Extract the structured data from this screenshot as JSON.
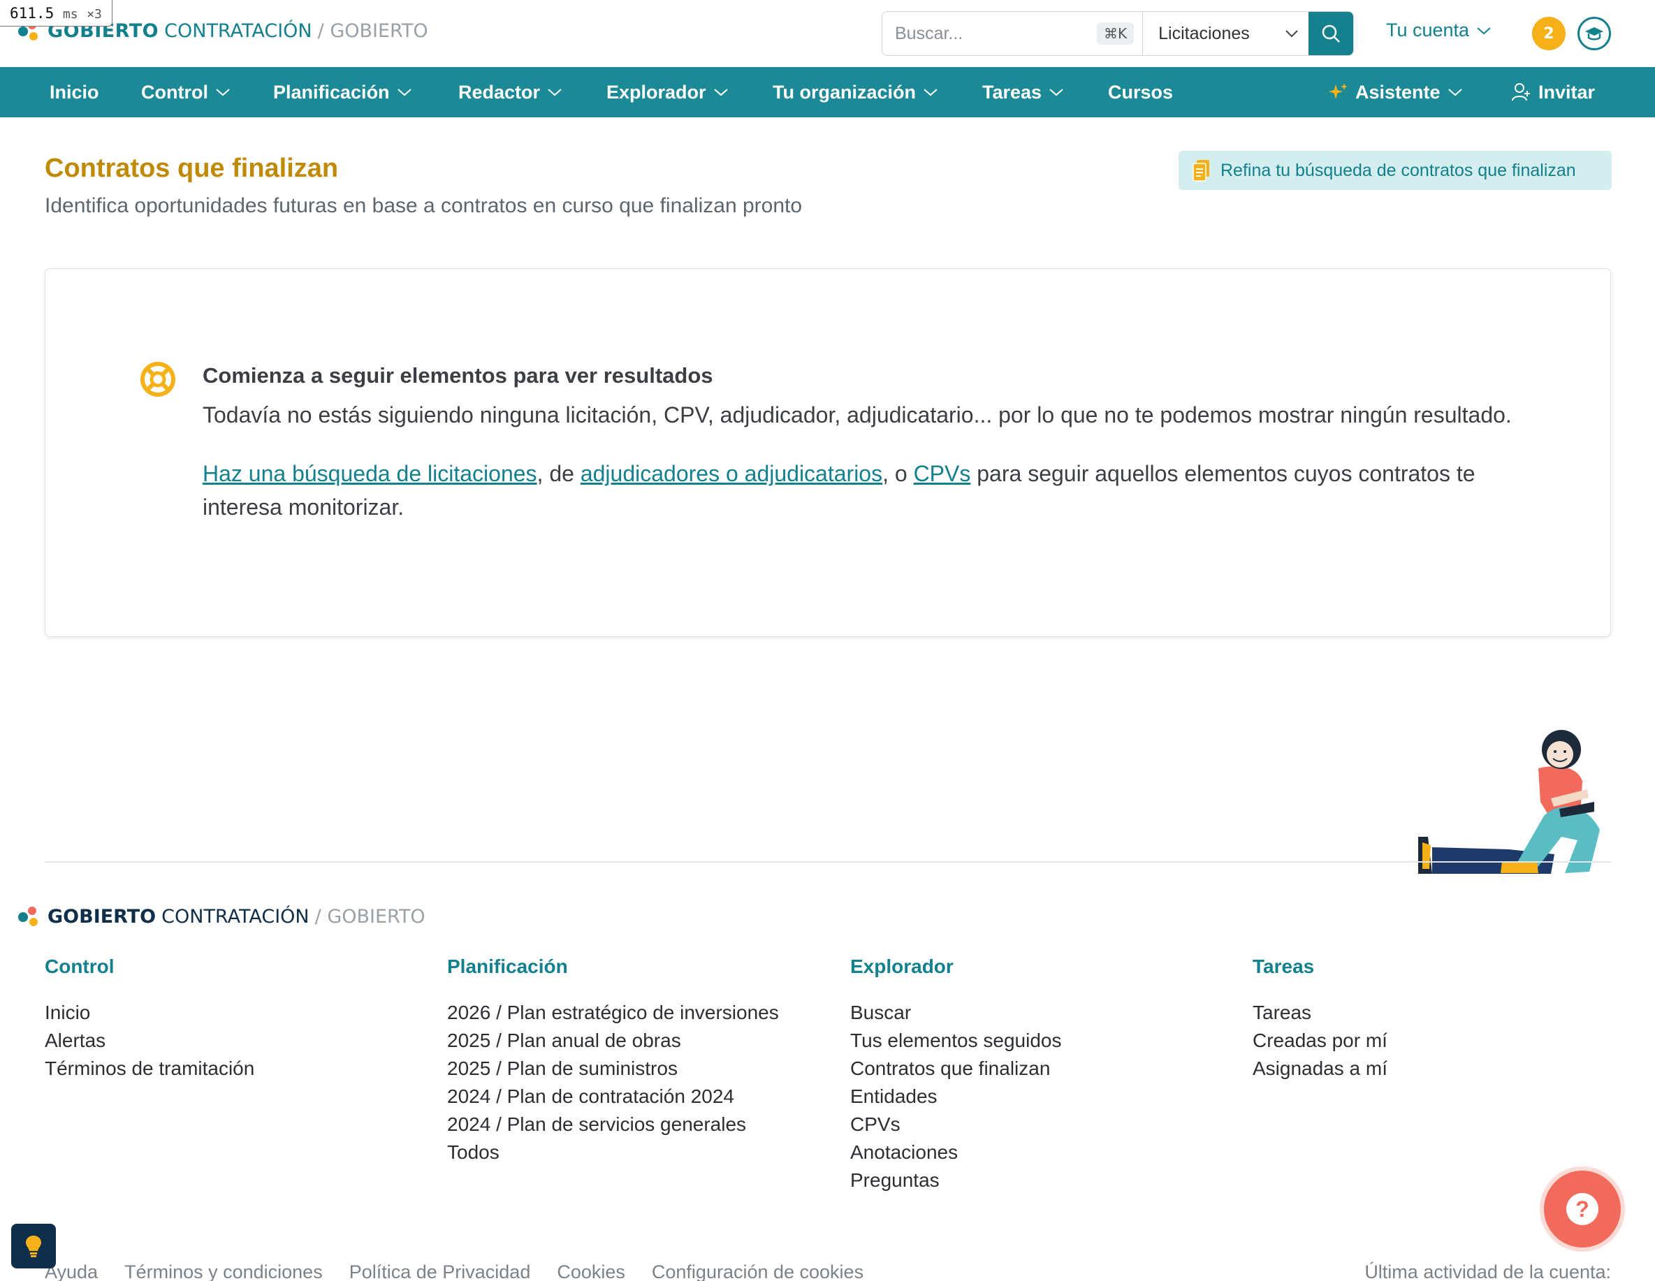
{
  "perf": {
    "value": "611.5",
    "unit": "ms",
    "mult": "×3"
  },
  "brand": {
    "strong": "GOBIERTO",
    "light": "CONTRATACIÓN",
    "sep": "/ GOBIERTO"
  },
  "search": {
    "placeholder": "Buscar...",
    "shortcut": "⌘K",
    "scope": "Licitaciones"
  },
  "account": {
    "label": "Tu cuenta",
    "notifications": "2"
  },
  "nav": {
    "items": [
      {
        "label": "Inicio"
      },
      {
        "label": "Control"
      },
      {
        "label": "Planificación"
      },
      {
        "label": "Redactor"
      },
      {
        "label": "Explorador"
      },
      {
        "label": "Tu organización"
      },
      {
        "label": "Tareas"
      },
      {
        "label": "Cursos"
      }
    ],
    "assistant": "Asistente",
    "invite": "Invitar"
  },
  "page": {
    "title": "Contratos que finalizan",
    "subtitle": "Identifica oportunidades futuras en base a contratos en curso que finalizan pronto",
    "refine": "Refina tu búsqueda de contratos que finalizan"
  },
  "empty": {
    "heading": "Comienza a seguir elementos para ver resultados",
    "text": "Todavía no estás siguiendo ninguna licitación, CPV, adjudicador, adjudicatario... por lo que no te podemos mostrar ningún resultado.",
    "link1": "Haz una búsqueda de licitaciones",
    "mid1": ", de ",
    "link2": "adjudicadores o adjudicatarios",
    "mid2": ", o ",
    "link3": "CPVs",
    "tail": " para seguir aquellos elementos cuyos contratos te interesa monitorizar."
  },
  "footer": {
    "columns": [
      {
        "title": "Control",
        "links": [
          "Inicio",
          "Alertas",
          "Términos de tramitación"
        ]
      },
      {
        "title": "Planificación",
        "links": [
          "2026 / Plan estratégico de inversiones",
          "2025 / Plan anual de obras",
          "2025 / Plan de suministros",
          "2024 / Plan de contratación 2024",
          "2024 / Plan de servicios generales",
          "Todos"
        ]
      },
      {
        "title": "Explorador",
        "links": [
          "Buscar",
          "Tus elementos seguidos",
          "Contratos que finalizan",
          "Entidades",
          "CPVs",
          "Anotaciones",
          "Preguntas"
        ]
      },
      {
        "title": "Tareas",
        "links": [
          "Tareas",
          "Creadas por mí",
          "Asignadas a mí"
        ]
      }
    ],
    "legal": [
      "Ayuda",
      "Términos y condiciones",
      "Política de Privacidad",
      "Cookies",
      "Configuración de cookies"
    ],
    "last_activity": "Última actividad de la cuenta:"
  },
  "colors": {
    "teal": "#1b8a96",
    "gold": "#c08a06",
    "coral": "#f26a5c",
    "yellow": "#f5b117",
    "navy": "#0f2e4a"
  }
}
